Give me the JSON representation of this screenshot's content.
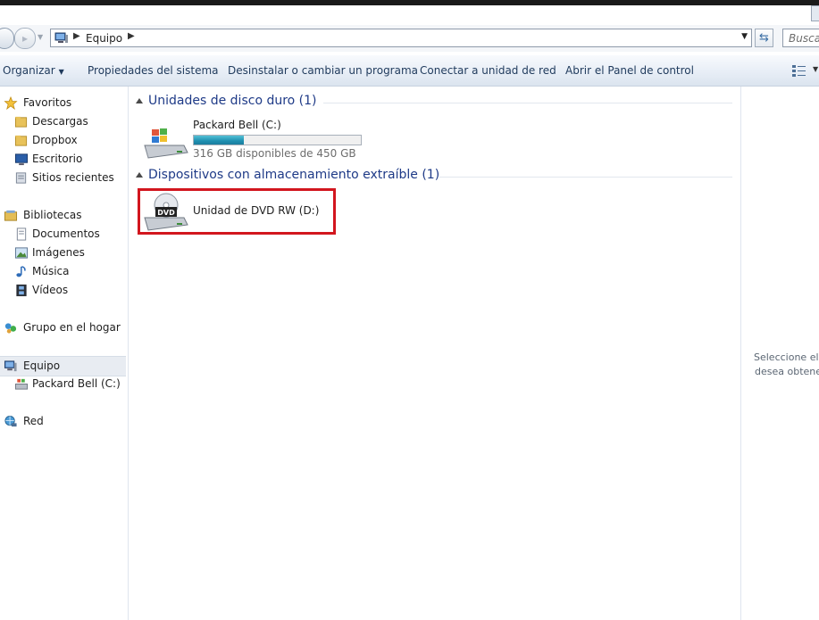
{
  "address": {
    "crumb": "Equipo",
    "search_placeholder": "Buscar"
  },
  "toolbar": {
    "organize": "Organizar",
    "system_properties": "Propiedades del sistema",
    "uninstall": "Desinstalar o cambiar un programa",
    "map_drive": "Conectar a unidad de red",
    "control_panel": "Abrir el Panel de control"
  },
  "nav": {
    "favorites": "Favoritos",
    "downloads": "Descargas",
    "dropbox": "Dropbox",
    "desktop": "Escritorio",
    "recent": "Sitios recientes",
    "libraries": "Bibliotecas",
    "documents": "Documentos",
    "images": "Imágenes",
    "music": "Música",
    "videos": "Vídeos",
    "homegroup": "Grupo en el hogar",
    "computer": "Equipo",
    "drive_c": "Packard Bell (C:)",
    "network": "Red"
  },
  "groups": {
    "hard_disks": "Unidades de disco duro (1)",
    "removable": "Dispositivos con almacenamiento extraíble (1)"
  },
  "drives": {
    "c": {
      "name": "Packard Bell (C:)",
      "free_text": "316 GB disponibles de 450 GB",
      "used_fraction": 0.3
    },
    "d": {
      "name": "Unidad de DVD RW (D:)",
      "badge": "DVD"
    }
  },
  "details": {
    "line1": "Seleccione el a",
    "line2": "desea obtener"
  },
  "colors": {
    "highlight": "#d2161e",
    "group_header": "#1e3a87",
    "bar_fill": "#1f8fb0"
  }
}
